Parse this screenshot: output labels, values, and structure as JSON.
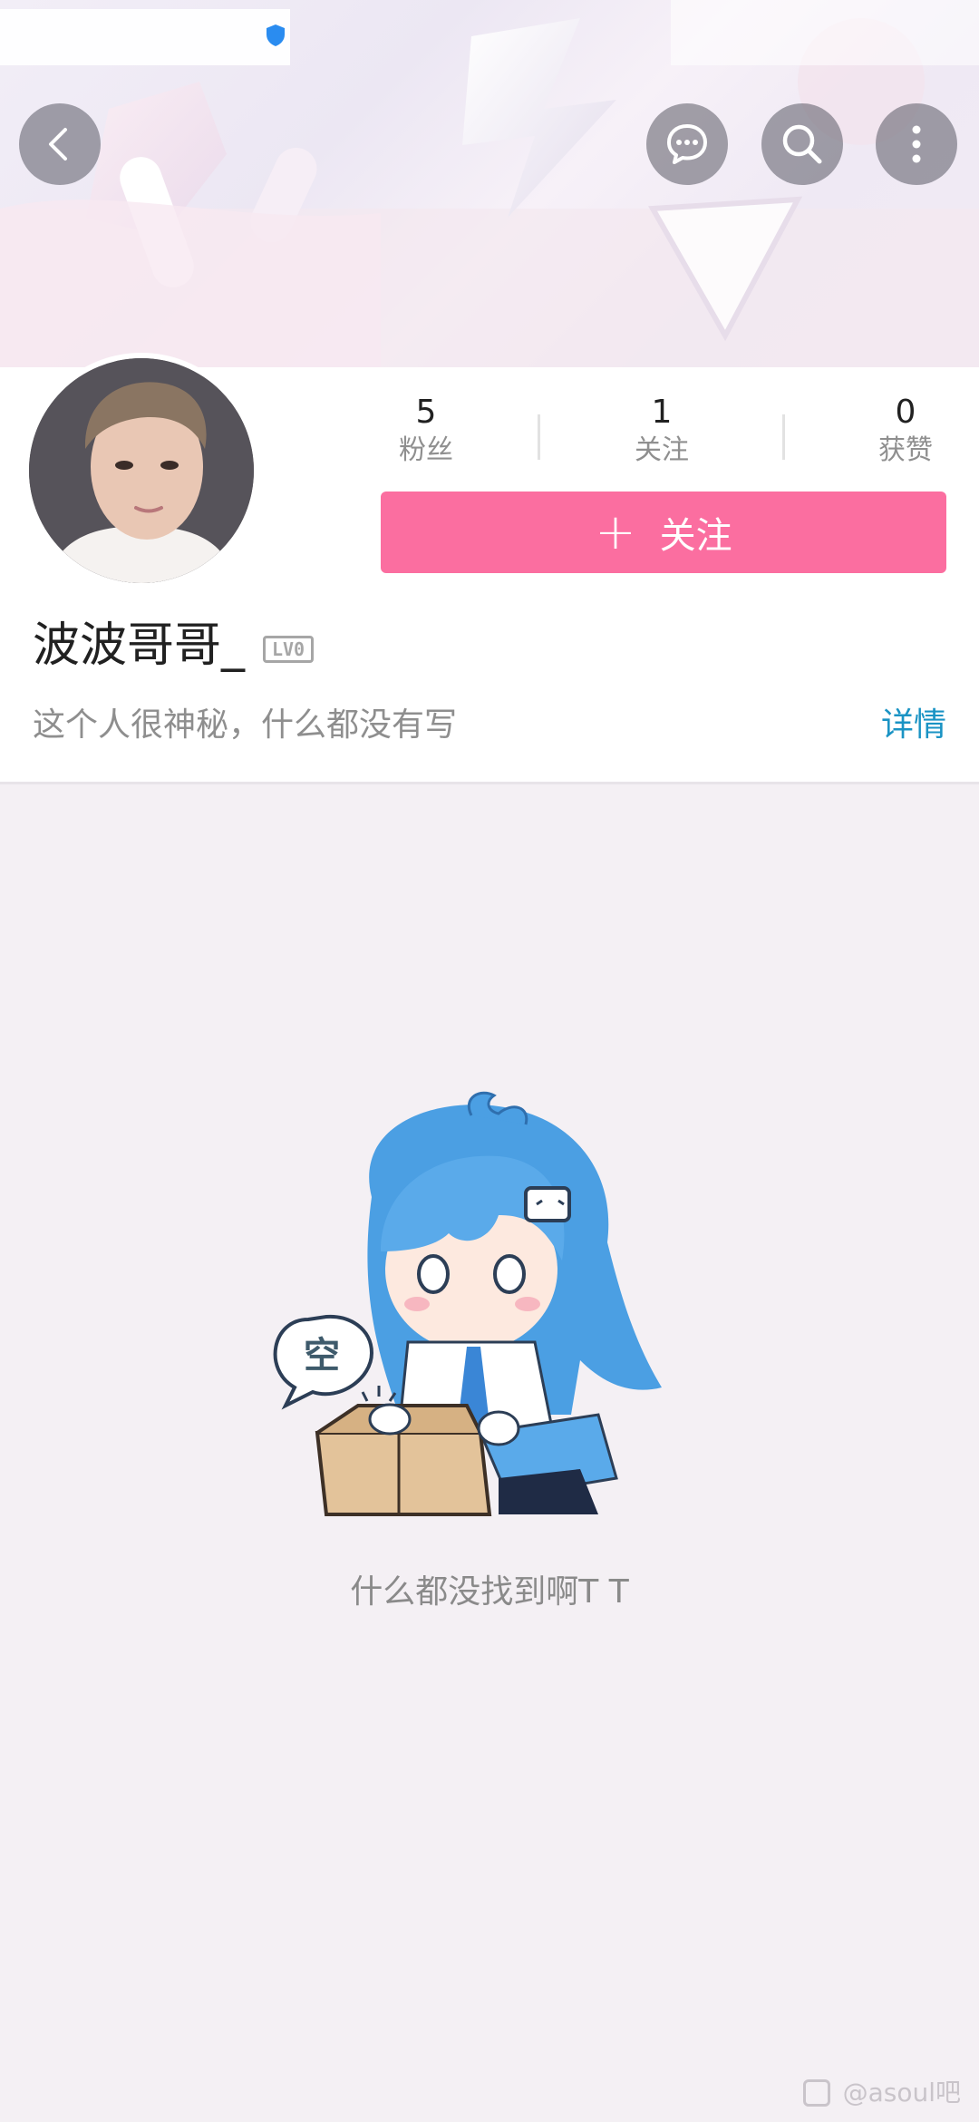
{
  "header": {
    "back_icon": "chevron-left-icon",
    "message_icon": "chat-bubble-icon",
    "search_icon": "search-icon",
    "more_icon": "more-vertical-icon"
  },
  "profile": {
    "stats": [
      {
        "value": "5",
        "label": "粉丝"
      },
      {
        "value": "1",
        "label": "关注"
      },
      {
        "value": "0",
        "label": "获赞"
      }
    ],
    "follow_plus": "+",
    "follow_label": "关注",
    "username": "波波哥哥_",
    "level_badge": "LV0",
    "bio": "这个人很神秘，什么都没有写",
    "detail_link": "详情"
  },
  "empty_state": {
    "bubble_text": "空",
    "message": "什么都没找到啊T T"
  },
  "watermark": "@asoul吧",
  "colors": {
    "accent_pink": "#fb6ea0",
    "link_blue": "#1a93c4",
    "page_bg": "#f4f0f4"
  }
}
